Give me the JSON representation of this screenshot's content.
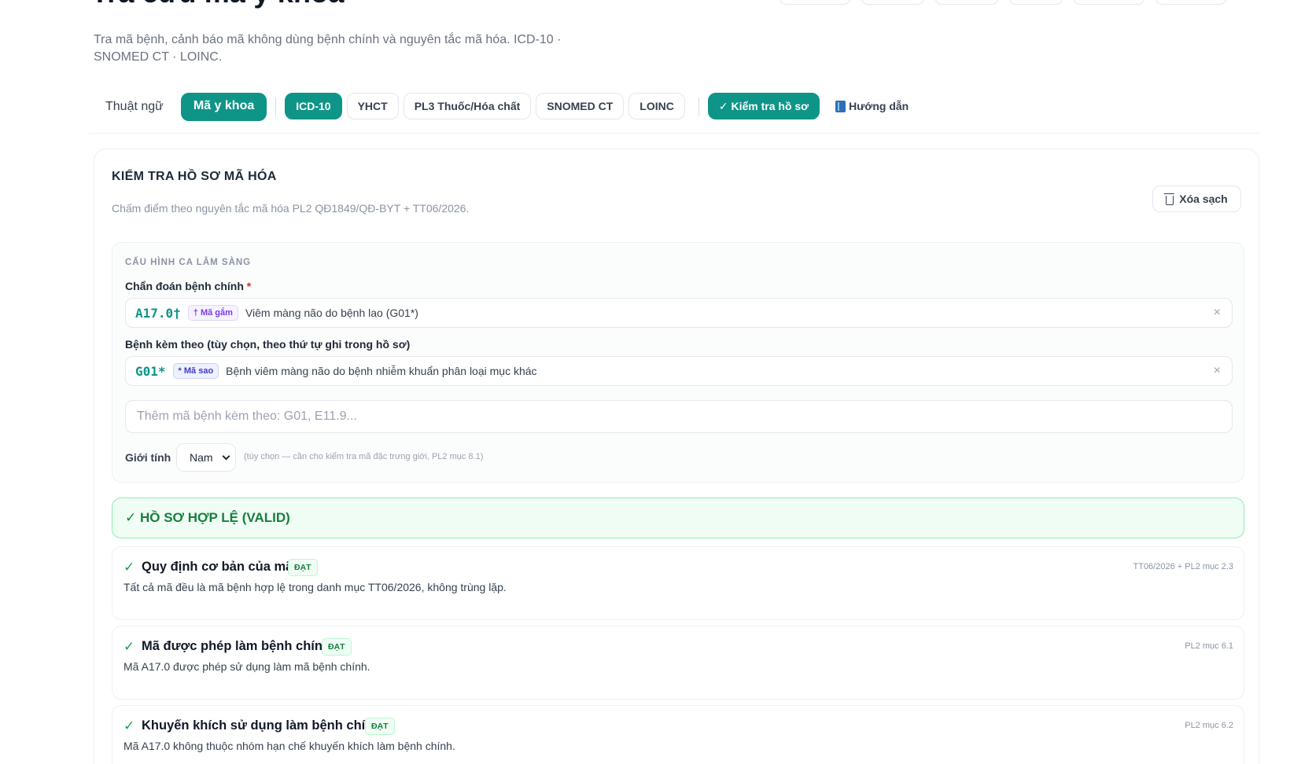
{
  "page": {
    "title": "Tra cứu mã y khoa",
    "subtitle": "Tra mã bệnh, cảnh báo mã không dùng bệnh chính và nguyên tắc mã hóa. ICD-10 · SNOMED CT · LOINC."
  },
  "tabs": {
    "thuat_ngu": "Thuật ngữ",
    "ma_y_khoa": "Mã y khoa"
  },
  "chips": {
    "icd10": "ICD-10",
    "yhct": "YHCT",
    "pl3": "PL3 Thuốc/Hóa chất",
    "snomed": "SNOMED CT",
    "loinc": "LOINC",
    "kiem_tra": "✓ Kiểm tra hồ sơ",
    "huong_dan": "Hướng dẫn"
  },
  "card": {
    "title": "KIỂM TRA HỒ SƠ MÃ HÓA",
    "subtitle": "Chấm điểm theo nguyên tắc mã hóa PL2 QĐ1849/QĐ-BYT + TT06/2026.",
    "clear_label": "Xóa sạch"
  },
  "config": {
    "heading": "CẤU HÌNH CA LÂM SÀNG",
    "primary_label": "Chẩn đoán bệnh chính",
    "required_mark": "*",
    "primary": {
      "code": "A17.0†",
      "badge": "† Mã gắm",
      "description": "Viêm màng não do bệnh lao (G01*)"
    },
    "secondary_label": "Bệnh kèm theo (tùy chọn, theo thứ tự ghi trong hồ sơ)",
    "secondary": [
      {
        "code": "G01*",
        "badge": "* Mã sao",
        "description": "Bệnh viêm màng não do bệnh nhiễm khuẩn phân loại mục khác"
      }
    ],
    "add_placeholder": "Thêm mã bệnh kèm theo: G01, E11.9...",
    "gender_label": "Giới tính",
    "gender_value": "Nam",
    "gender_hint": "(tùy chọn — cần cho kiểm tra mã đặc trưng giới, PL2 mục 8.1)",
    "remove_symbol": "×"
  },
  "result": {
    "status": "✓ HỒ SƠ HỢP LỆ (VALID)",
    "pass_label": "ĐẠT",
    "check_symbol": "✓",
    "rules": [
      {
        "title": "Quy định cơ bản của mã",
        "ref": "TT06/2026 + PL2 mục 2.3",
        "description": "Tất cả mã đều là mã bệnh hợp lệ trong danh mục TT06/2026, không trùng lặp."
      },
      {
        "title": "Mã được phép làm bệnh chính",
        "ref": "PL2 mục 6.1",
        "description": "Mã A17.0 được phép sử dụng làm mã bệnh chính."
      },
      {
        "title": "Khuyến khích sử dụng làm bệnh chính",
        "ref": "PL2 mục 6.2",
        "description": "Mã A17.0 không thuộc nhóm hạn chế khuyến khích làm bệnh chính."
      }
    ]
  }
}
